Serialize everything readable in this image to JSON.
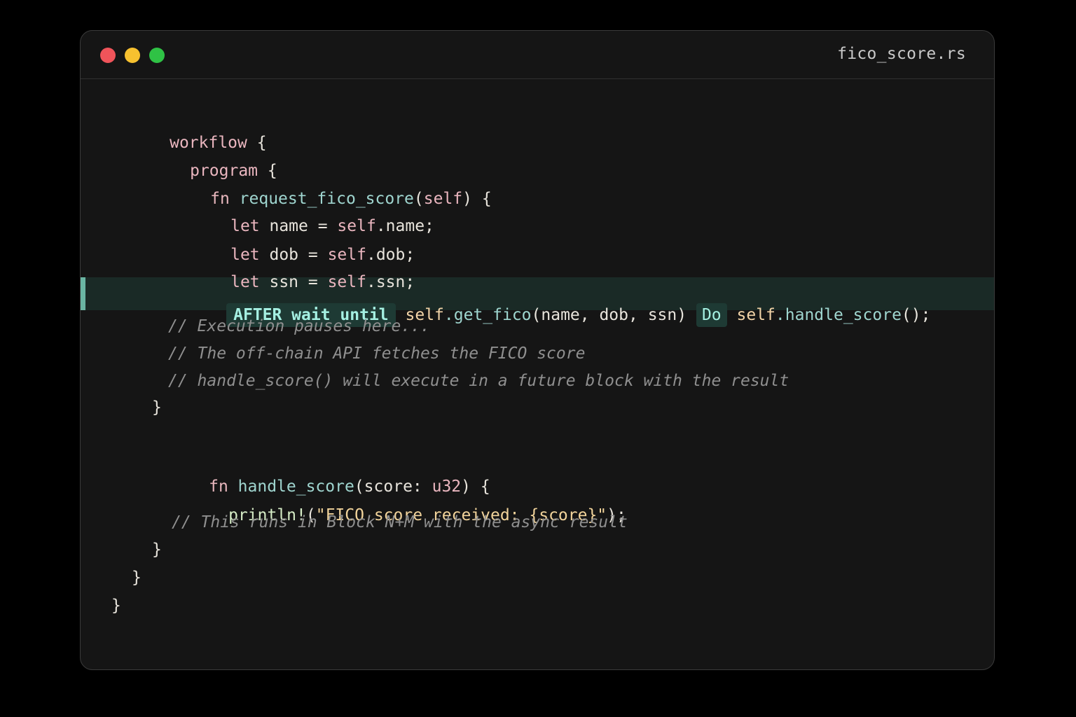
{
  "window": {
    "filename": "fico_score.rs",
    "traffic_lights": [
      "close",
      "minimize",
      "zoom"
    ]
  },
  "code": {
    "l1_kw": "workflow",
    "l1_brace": "{",
    "l2_kw": "program",
    "l2_brace": "{",
    "l3_fn": "fn",
    "l3_name": "request_fico_score",
    "l3_paren_open": "(",
    "l3_self": "self",
    "l3_tail": ") {",
    "l4_let": "let",
    "l4_var": " name = ",
    "l4_self": "self",
    "l4_tail": ".name;",
    "l5_let": "let",
    "l5_var": " dob = ",
    "l5_self": "self",
    "l5_tail": ".dob;",
    "l6_let": "let",
    "l6_var": " ssn = ",
    "l6_self": "self",
    "l6_tail": ".ssn;",
    "l7_badge": "AFTER wait until",
    "l7_self": "self",
    "l7_call": ".get_fico",
    "l7_args": "(name, dob, ssn)",
    "l7_do": "Do",
    "l7_self2": "self",
    "l7_call2": ".handle_score",
    "l7_end": "();",
    "c1": "// Execution pauses here...",
    "c2": "// The off-chain API fetches the FICO score",
    "c3": "// handle_score() will execute in a future block with the result",
    "close1": "}",
    "l9_fn": "fn",
    "l9_name": "handle_score",
    "l9_params_open": "(score: ",
    "l9_type": "u32",
    "l9_tail": ") {",
    "l10_macro": "println!",
    "l10_open": "(",
    "l10_str": "\"FICO score received: {score}\"",
    "l10_end": ");",
    "c4": "// This runs in Block N+M with the async result",
    "close2": "}",
    "close3": "}",
    "close4": "}"
  }
}
